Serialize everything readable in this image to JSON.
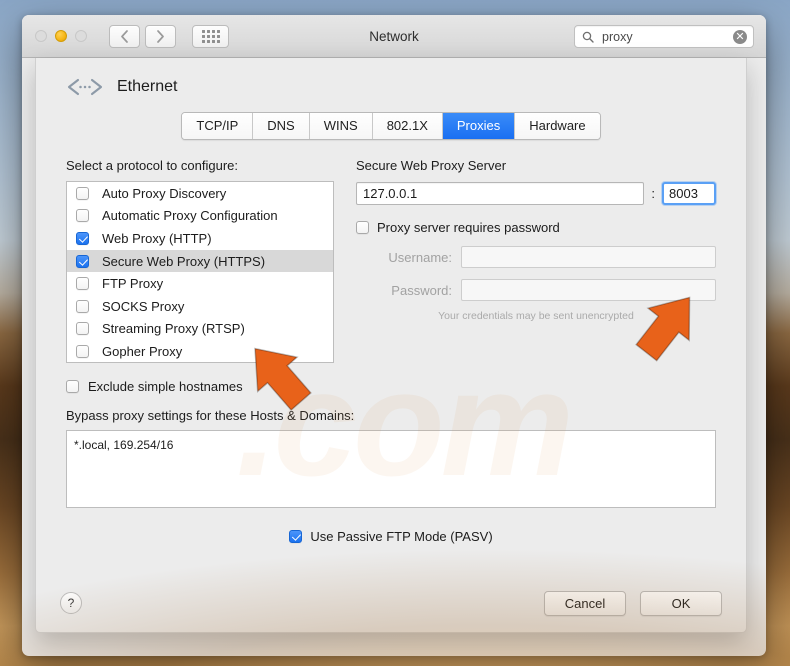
{
  "window": {
    "title": "Network",
    "traffic_lights": [
      {
        "name": "close",
        "state": "inactive"
      },
      {
        "name": "minimize",
        "state": "amber"
      },
      {
        "name": "zoom",
        "state": "inactive"
      }
    ],
    "nav": {
      "back_icon": "chevron-left-icon",
      "forward_icon": "chevron-right-icon",
      "showall_icon": "grid-dots-icon"
    },
    "search": {
      "value": "proxy",
      "placeholder": "Search",
      "icon": "search-icon",
      "clear_icon": "clear-icon",
      "clear_glyph": "✕"
    }
  },
  "service": {
    "name": "Ethernet",
    "icon": "ethernet-icon"
  },
  "tabs": [
    {
      "label": "TCP/IP",
      "selected": false
    },
    {
      "label": "DNS",
      "selected": false
    },
    {
      "label": "WINS",
      "selected": false
    },
    {
      "label": "802.1X",
      "selected": false
    },
    {
      "label": "Proxies",
      "selected": true
    },
    {
      "label": "Hardware",
      "selected": false
    }
  ],
  "protocols": {
    "label": "Select a protocol to configure:",
    "items": [
      {
        "label": "Auto Proxy Discovery",
        "checked": false,
        "selected": false
      },
      {
        "label": "Automatic Proxy Configuration",
        "checked": false,
        "selected": false
      },
      {
        "label": "Web Proxy (HTTP)",
        "checked": true,
        "selected": false
      },
      {
        "label": "Secure Web Proxy (HTTPS)",
        "checked": true,
        "selected": true
      },
      {
        "label": "FTP Proxy",
        "checked": false,
        "selected": false
      },
      {
        "label": "SOCKS Proxy",
        "checked": false,
        "selected": false
      },
      {
        "label": "Streaming Proxy (RTSP)",
        "checked": false,
        "selected": false
      },
      {
        "label": "Gopher Proxy",
        "checked": false,
        "selected": false
      }
    ]
  },
  "server": {
    "title": "Secure Web Proxy Server",
    "host": "127.0.0.1",
    "host_placeholder": "",
    "separator": ":",
    "port": "8003",
    "port_placeholder": "",
    "requires_password_label": "Proxy server requires password",
    "requires_password_checked": false,
    "username_label": "Username:",
    "username_value": "",
    "password_label": "Password:",
    "password_value": "",
    "credentials_note": "Your credentials may be sent unencrypted"
  },
  "bypass": {
    "exclude_label": "Exclude simple hostnames",
    "exclude_checked": false,
    "list_label": "Bypass proxy settings for these Hosts & Domains:",
    "list_value": "*.local, 169.254/16"
  },
  "pasv": {
    "label": "Use Passive FTP Mode (PASV)",
    "checked": true
  },
  "footer": {
    "help_label": "?",
    "cancel_label": "Cancel",
    "ok_label": "OK"
  },
  "watermark": {
    "text": ".com"
  },
  "annotations": [
    {
      "name": "arrow-to-protocol-list",
      "color": "#E8621A"
    },
    {
      "name": "arrow-to-port-field",
      "color": "#E8621A"
    }
  ],
  "colors": {
    "accent": "#1b72f0",
    "tab_selected": "#2a7ef5",
    "arrow": "#E8621A"
  }
}
